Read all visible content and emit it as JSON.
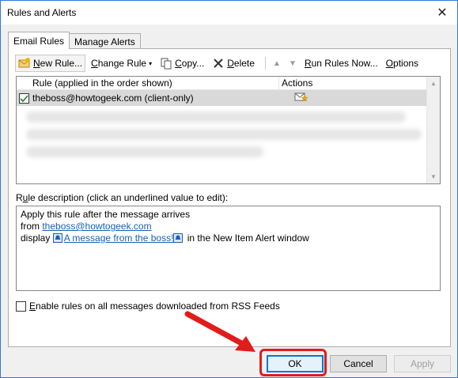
{
  "window": {
    "title": "Rules and Alerts",
    "close_glyph": "✕"
  },
  "tabs": [
    {
      "label": "Email Rules",
      "active": true
    },
    {
      "label": "Manage Alerts",
      "active": false
    }
  ],
  "toolbar": {
    "new_rule_mnemonic": "N",
    "new_rule_rest": "ew Rule...",
    "change_rule_mnemonic": "C",
    "change_rule_rest": "hange Rule",
    "copy_mnemonic": "C",
    "copy_rest": "opy...",
    "delete_mnemonic": "D",
    "delete_rest": "elete",
    "move_up_glyph": "▲",
    "move_down_glyph": "▼",
    "run_rules_mnemonic": "R",
    "run_rules_rest": "un Rules Now...",
    "options_mnemonic": "O",
    "options_rest": "ptions",
    "caret_glyph": "▾"
  },
  "rules_list": {
    "columns": [
      "Rule (applied in the order shown)",
      "Actions"
    ],
    "rows": [
      {
        "name": "theboss@howtogeek.com  (client-only)",
        "checked": true,
        "action_icon": "envelope-star-icon"
      }
    ]
  },
  "description": {
    "label_mnemonic": "u",
    "label_before": "R",
    "label_after": "le description (click an underlined value to edit):",
    "line1": "Apply this rule after the message arrives",
    "line2_prefix": "from ",
    "line2_link": "theboss@howtogeek.com",
    "line3_prefix": "display ",
    "line3_link": "A message from the boss!",
    "line3_suffix": " in the New Item Alert window"
  },
  "rss": {
    "label_mnemonic": "E",
    "label_rest": "nable rules on all messages downloaded from RSS Feeds",
    "checked": false
  },
  "buttons": {
    "ok": "OK",
    "cancel": "Cancel",
    "apply": "Apply"
  },
  "colors": {
    "accent": "#0078d7",
    "highlight": "#e21b1b",
    "link": "#1a5fb4"
  }
}
